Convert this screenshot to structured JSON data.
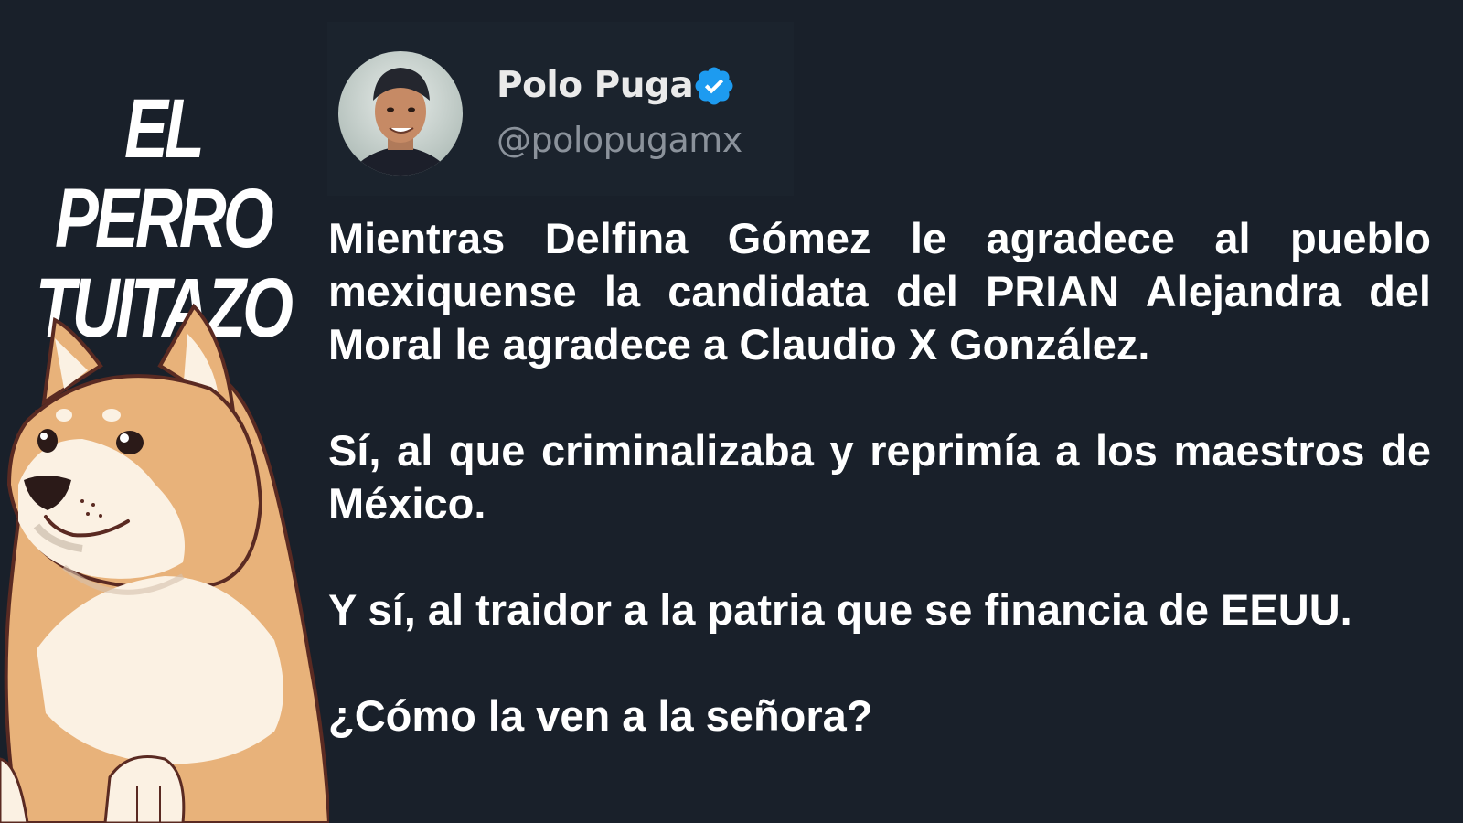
{
  "brand": {
    "line1": "EL PERRO",
    "line2": "TUITAZO"
  },
  "tweet": {
    "author": {
      "display_name": "Polo Puga",
      "handle": "@polopugamx",
      "verified": true
    },
    "paragraphs": [
      "Mientras Delfina Gómez le agradece al pueblo mexiquense la candidata del PRIAN Alejandra del Moral le agradece a Claudio X González.",
      "Sí, al que criminalizaba y reprimía a los maestros de México.",
      "Y sí, al traidor a la patria que se financia de EEUU.",
      "¿Cómo la ven a la señora?"
    ]
  },
  "icons": {
    "verified": "verified-badge-icon",
    "mascot": "shiba-dog-illustration",
    "avatar": "avatar-photo"
  },
  "colors": {
    "background": "#19202a",
    "text": "#ffffff",
    "handle": "#8b929b",
    "verified_blue": "#1d9bf0",
    "dog_tan": "#e8b27a",
    "dog_cream": "#fbf1e3"
  }
}
